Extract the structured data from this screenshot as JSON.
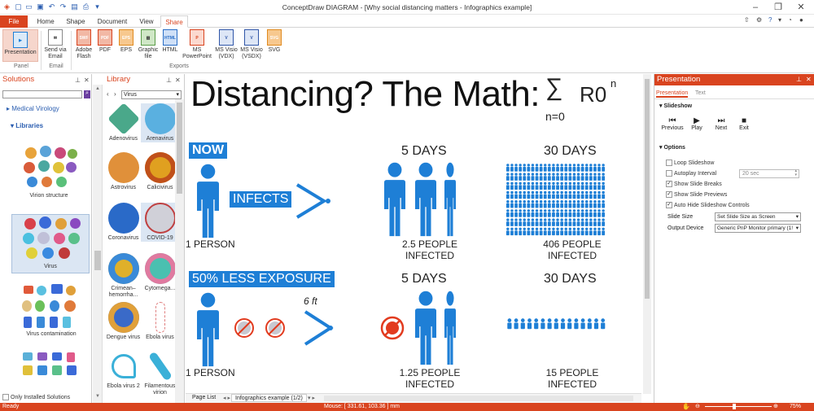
{
  "window": {
    "title": "ConceptDraw DIAGRAM - [Why social distancing matters - Infographics example]",
    "controls": [
      "–",
      "❐",
      "✕"
    ]
  },
  "ribbon_tabs": [
    "File",
    "Home",
    "Shape",
    "Document",
    "View",
    "Share"
  ],
  "ribbon_right": "?",
  "ribbon": {
    "buttons": [
      {
        "label": "Presentation",
        "icon": "presentation-icon"
      },
      {
        "label": "Send via Email",
        "icon": "email-icon"
      },
      {
        "label": "Adobe Flash",
        "icon": "swf-icon",
        "badge": "SWF"
      },
      {
        "label": "PDF",
        "icon": "pdf-icon",
        "badge": "PDF"
      },
      {
        "label": "EPS",
        "icon": "eps-icon",
        "badge": "EPS"
      },
      {
        "label": "Graphic file",
        "icon": "graphic-file-icon"
      },
      {
        "label": "HTML",
        "icon": "html-icon",
        "badge": "HTML"
      },
      {
        "label": "MS PowerPoint",
        "icon": "powerpoint-icon"
      },
      {
        "label": "MS Visio (VDX)",
        "icon": "visio-vdx-icon",
        "badge": "V"
      },
      {
        "label": "MS Visio (VSDX)",
        "icon": "visio-vsdx-icon",
        "badge": "V"
      },
      {
        "label": "SVG",
        "icon": "svg-icon",
        "badge": "SVG"
      }
    ],
    "groups": [
      "Panel",
      "Email",
      "Exports"
    ]
  },
  "solutions": {
    "title": "Solutions",
    "tree_item": "Medical Virology",
    "section": "Libraries",
    "items": [
      "Virion structure",
      "Virus",
      "Virus contamination"
    ],
    "footer_checkbox": "Only Installed Solutions"
  },
  "library": {
    "title": "Library",
    "selected": "Virus",
    "items": [
      "Adenovirus",
      "Arenavirus",
      "Astrovirus",
      "Calicivirus",
      "Coronavirus",
      "COVID-19",
      "Crimean–hemorrha...",
      "Cytomega...",
      "Dengue virus",
      "Ebola virus",
      "Ebola virus 2",
      "Filamentous virion"
    ]
  },
  "canvas": {
    "headline": "Distancing? The Math:",
    "formula_top": "n",
    "formula_sigma": "∑",
    "formula_main": "R0",
    "formula_bottom": "n=0",
    "row1": {
      "tag": "NOW",
      "verb": "INFECTS",
      "col2_head": "5 DAYS",
      "col3_head": "30 DAYS",
      "col1_foot": "1 PERSON",
      "col2_foot_1": "2.5 PEOPLE",
      "col2_foot_2": "INFECTED",
      "col3_foot_1": "406 PEOPLE",
      "col3_foot_2": "INFECTED"
    },
    "row2": {
      "tag": "50% LESS EXPOSURE",
      "distance": "6 ft",
      "col2_head": "5 DAYS",
      "col3_head": "30 DAYS",
      "col1_foot": "1 PERSON",
      "col2_foot_1": "1.25 PEOPLE",
      "col2_foot_2": "INFECTED",
      "col3_foot_1": "15 PEOPLE",
      "col3_foot_2": "INFECTED"
    },
    "page_list": "Page List",
    "page_tab": "Infographics example (1/2)"
  },
  "presentation": {
    "title": "Presentation",
    "tabs": [
      "Presentation",
      "Text"
    ],
    "slideshow": "Slideshow",
    "controls": [
      "Previous",
      "Play",
      "Next",
      "Exit"
    ],
    "options": "Options",
    "checks": [
      {
        "label": "Loop Slideshow",
        "checked": false
      },
      {
        "label": "Autoplay Interval",
        "checked": false
      },
      {
        "label": "Show Slide Breaks",
        "checked": true
      },
      {
        "label": "Show Slide Previews",
        "checked": true
      },
      {
        "label": "Auto Hide Slideshow Controls",
        "checked": true
      }
    ],
    "interval": "20 sec",
    "slide_size_label": "Slide Size",
    "slide_size_value": "Set Slide Size as Screen",
    "output_label": "Output Device",
    "output_value": "Generic PnP Monitor primary (1!"
  },
  "status": {
    "ready": "Ready",
    "mouse": "Mouse: [ 331.61, 103.36 ] mm",
    "zoom": "75%"
  },
  "colors": {
    "accent": "#d9441f",
    "infographic_blue": "#1e7fd6",
    "virus_red": "#e23b1f"
  }
}
